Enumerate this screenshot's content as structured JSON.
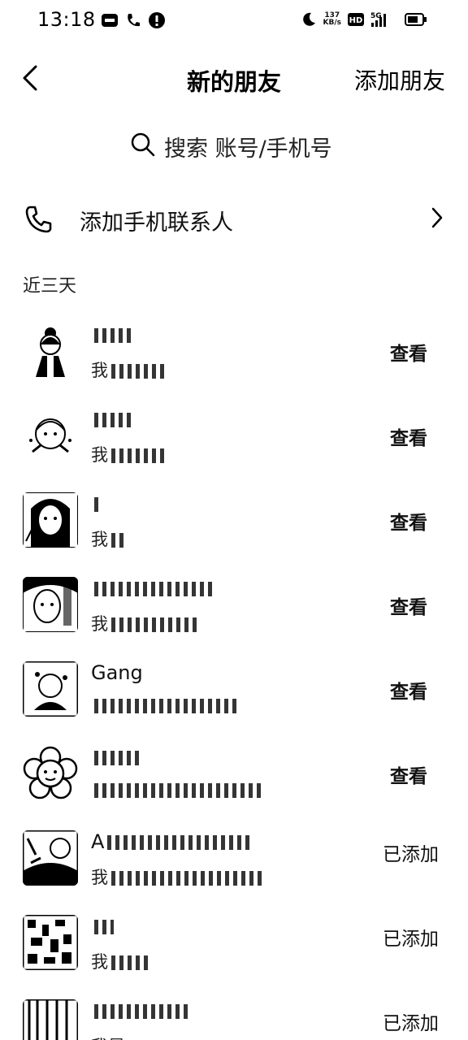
{
  "status_bar": {
    "time": "13:18",
    "speed_value": "137",
    "speed_unit": "KB/s",
    "network": "5G"
  },
  "nav": {
    "title": "新的朋友",
    "action_label": "添加朋友"
  },
  "search": {
    "placeholder": "搜索 账号/手机号"
  },
  "add_contacts": {
    "label": "添加手机联系人"
  },
  "section": {
    "label": "近三天"
  },
  "friends": [
    {
      "name": "",
      "message": "我",
      "action": "查看",
      "avatar_icon": "girl-cartoon"
    },
    {
      "name": "",
      "message": "我",
      "action": "查看",
      "avatar_icon": "baby-cartoon"
    },
    {
      "name": "",
      "message": "我",
      "action": "查看",
      "avatar_icon": "anime-girl"
    },
    {
      "name": "",
      "message": "我",
      "action": "查看",
      "avatar_icon": "photo-man"
    },
    {
      "name": "Gang",
      "message": "",
      "action": "查看",
      "avatar_icon": "photo-baby"
    },
    {
      "name": "",
      "message": "",
      "action": "查看",
      "avatar_icon": "flower"
    },
    {
      "name": "A",
      "message": "我",
      "action": "已添加",
      "avatar_icon": "photo-child"
    },
    {
      "name": "",
      "message": "我",
      "action": "已添加",
      "avatar_icon": "photo-pattern"
    },
    {
      "name": "",
      "message": "我是",
      "action": "已添加",
      "avatar_icon": "photo-stripes"
    }
  ]
}
